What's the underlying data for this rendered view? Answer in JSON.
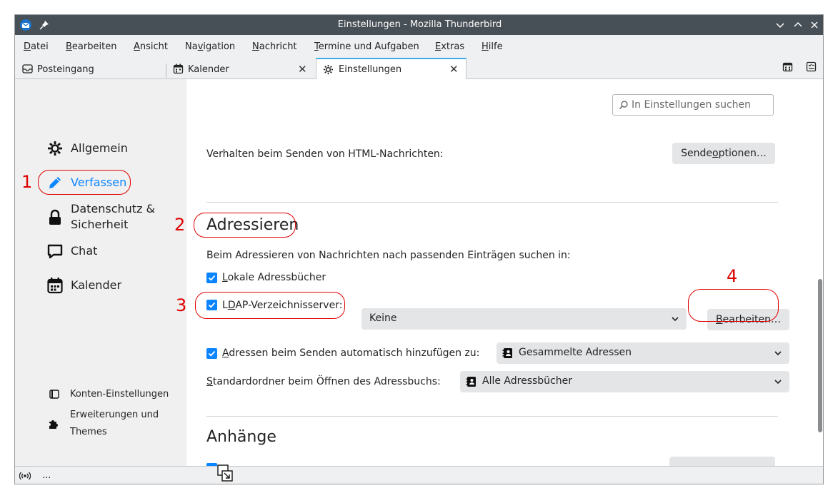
{
  "window": {
    "title": "Einstellungen - Mozilla Thunderbird"
  },
  "menubar": {
    "items": [
      {
        "pre": "",
        "u": "D",
        "post": "atei"
      },
      {
        "pre": "",
        "u": "B",
        "post": "earbeiten"
      },
      {
        "pre": "",
        "u": "A",
        "post": "nsicht"
      },
      {
        "pre": "Na",
        "u": "v",
        "post": "igation"
      },
      {
        "pre": "",
        "u": "N",
        "post": "achricht"
      },
      {
        "pre": "",
        "u": "T",
        "post": "ermine und Aufgaben"
      },
      {
        "pre": "",
        "u": "E",
        "post": "xtras"
      },
      {
        "pre": "",
        "u": "H",
        "post": "ilfe"
      }
    ]
  },
  "tabs": [
    {
      "label": "Posteingang",
      "icon": "inbox-icon"
    },
    {
      "label": "Kalender",
      "icon": "calendar-icon"
    },
    {
      "label": "Einstellungen",
      "icon": "gear-icon"
    }
  ],
  "sidebar": {
    "items": [
      {
        "label": "Allgemein",
        "icon": "gear-icon"
      },
      {
        "label": "Verfassen",
        "icon": "pencil-icon"
      },
      {
        "label1": "Datenschutz &",
        "label2": "Sicherheit",
        "icon": "lock-icon"
      },
      {
        "label": "Chat",
        "icon": "chat-icon"
      },
      {
        "label": "Kalender",
        "icon": "calendar-icon"
      }
    ],
    "footer": {
      "accounts": "Konten-Einstellungen",
      "addons1": "Erweiterungen und",
      "addons2": "Themes"
    }
  },
  "search": {
    "placeholder": "In Einstellungen suchen"
  },
  "html_send": {
    "label": "Verhalten beim Senden von HTML-Nachrichten:",
    "button_pre": "Sende",
    "button_u": "o",
    "button_post": "ptionen…"
  },
  "addressing": {
    "heading": "Adressieren",
    "intro": "Beim Adressieren von Nachrichten nach passenden Einträgen suchen in:",
    "local": {
      "u": "L",
      "post": "okale Adressbücher",
      "checked": true
    },
    "ldap": {
      "pre": "L",
      "u": "D",
      "post": "AP-Verzeichnisserver:",
      "checked": true,
      "value": "Keine"
    },
    "edit_button": {
      "u": "B",
      "post": "earbeiten…"
    },
    "auto_add": {
      "u": "A",
      "post": "dressen beim Senden automatisch hinzufügen zu:",
      "checked": true,
      "value": "Gesammelte Adressen"
    },
    "default_folder": {
      "u": "S",
      "post": "tandardordner beim Öffnen des Adressbuchs:",
      "value": "Alle Adressbücher"
    }
  },
  "attachments": {
    "heading": "Anhänge"
  },
  "status": {
    "text": "..."
  },
  "annotations": [
    "1",
    "2",
    "3",
    "4"
  ],
  "colors": {
    "accent": "#3daee9",
    "checkbox": "#0a84ff",
    "annotation": "#e00000",
    "titlebar": "#475057"
  }
}
